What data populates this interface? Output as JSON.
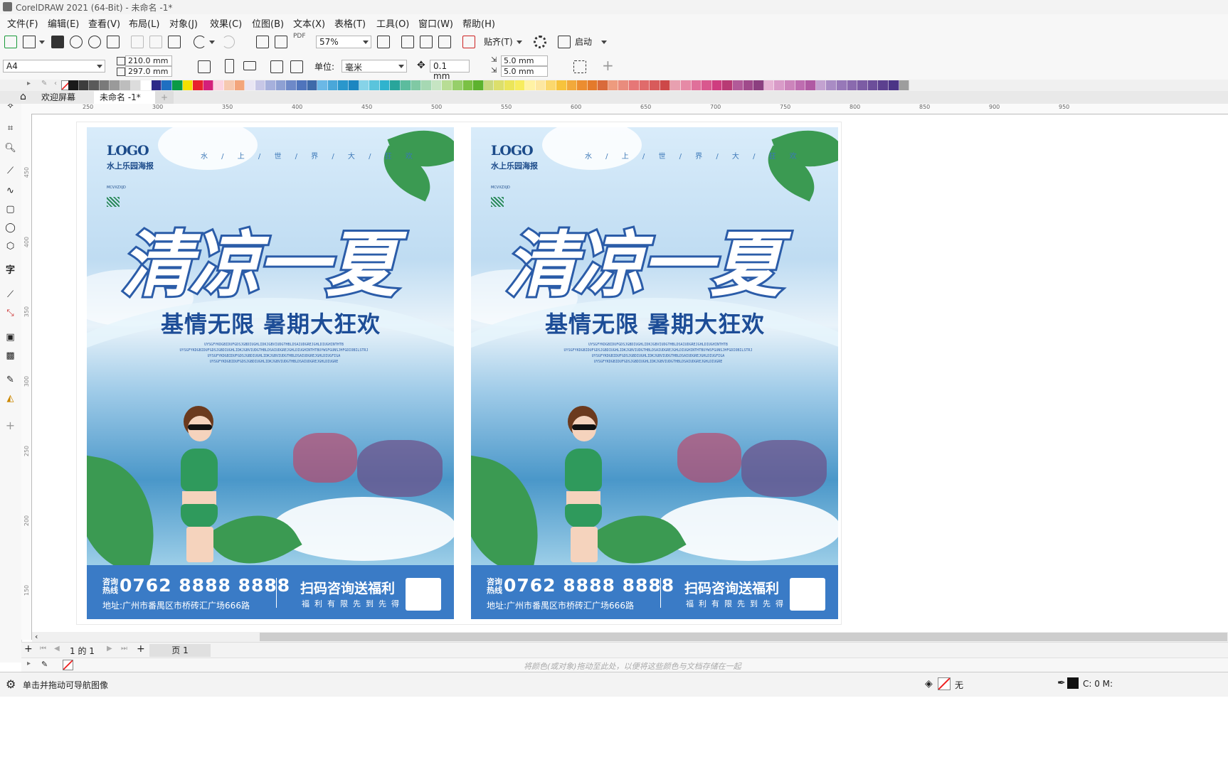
{
  "window": {
    "title": "CorelDRAW 2021 (64-Bit) - 未命名 -1*"
  },
  "menu": [
    "文件(F)",
    "编辑(E)",
    "查看(V)",
    "布局(L)",
    "对象(J)",
    "效果(C)",
    "位图(B)",
    "文本(X)",
    "表格(T)",
    "工具(O)",
    "窗口(W)",
    "帮助(H)"
  ],
  "toolbar": {
    "zoom": "57%",
    "snap_label": "贴齐(T)",
    "launch_label": "启动",
    "pdf_label": "PDF"
  },
  "propertybar": {
    "page_size": "A4",
    "width": "210.0 mm",
    "height": "297.0 mm",
    "units_label": "单位:",
    "units_value": "毫米",
    "nudge": "0.1 mm",
    "dup_x": "5.0 mm",
    "dup_y": "5.0 mm"
  },
  "palette": {
    "colors": [
      "#1a1a1a",
      "#3d3d3d",
      "#5a5a5a",
      "#7a7a7a",
      "#9a9a9a",
      "#bdbdbd",
      "#dcdcdc",
      "#ffffff",
      "#2d2a88",
      "#1f6fc1",
      "#0a9a46",
      "#f4e000",
      "#e8232d",
      "#d41f7a",
      "#fbd3e0",
      "#f6c9b0",
      "#f3a57b",
      "#e9e6f3",
      "#c7c7e6",
      "#a6b0dc",
      "#8ea0d3",
      "#6e89c8",
      "#4f74bc",
      "#3e6aa9",
      "#6bb8e6",
      "#4aa7d9",
      "#2a97cc",
      "#1c86c1",
      "#86d3e8",
      "#5bc4dc",
      "#30b3ce",
      "#29a59b",
      "#5cbc9e",
      "#80c9a4",
      "#a6d8b3",
      "#c6e5c3",
      "#b8dd95",
      "#97cf6a",
      "#7bc144",
      "#5db22e",
      "#c9d880",
      "#dcdf6c",
      "#ebe55a",
      "#f7ec5e",
      "#fff2a4",
      "#fde7a1",
      "#fbd86d",
      "#f7c33c",
      "#f2a93b",
      "#ec8d30",
      "#e47a2b",
      "#d96a3b",
      "#ee9b7e",
      "#e98c7d",
      "#e67777",
      "#e06b6b",
      "#d85b5b",
      "#cd4848",
      "#e8a0b0",
      "#e68aa6",
      "#e0709a",
      "#d9588e",
      "#cf3d80",
      "#b83a74",
      "#b25a99",
      "#a04a8b",
      "#8c3f80",
      "#e6b3d4",
      "#d99bc8",
      "#cc84bb",
      "#be6db0",
      "#b05aa3",
      "#c3a2d0",
      "#a98cc4",
      "#9778b8",
      "#8a6aae",
      "#7c5ca4",
      "#6c4e9a",
      "#5c408f",
      "#4b3486",
      "#9d9d9d"
    ]
  },
  "tabs": {
    "welcome": "欢迎屏幕",
    "document": "未命名 -1*",
    "add": "+"
  },
  "ruler_h": [
    "250",
    "300",
    "350",
    "400",
    "450",
    "500",
    "550",
    "600",
    "650",
    "700",
    "750",
    "800",
    "850",
    "900",
    "950"
  ],
  "ruler_v": [
    "450",
    "400",
    "350",
    "300",
    "250",
    "200",
    "150",
    "100",
    "50"
  ],
  "poster": {
    "logo": "LOGO",
    "sublogo": "水上乐园海报",
    "sublines": "MCVXZXJD",
    "tagline": "水 / 上 / 世 / 界 / 大 / 狂 欢",
    "headline": "清凉一夏",
    "subheadline": "基情无限 暑期大狂欢",
    "smallprint": "UYSGFYKDGBIDUFGDSJGBDIUGHLIDKJGBVIUDGTHBLDSAIUDGREJGHLDIUGHINTHTB UYSGFYKDGBIDUFGDSJGBDIUGHLIDKJGBVIUDGTHBLDSAIUDGREJGHLDIUGHINTHTBUYWSFGUNSJHFGDIOBILSTRJ UYSGFYKDGBIDUFGDSJGBDIUGHLIDKJGBVIUDGTHBLDSAIUDGREJGHLDIUGFIGA UYSGFYKDGBIDUFGDSJGBDIUGHLIDKJGBVIUDGTHBLDSAIUDGREJGHLDIUGRE",
    "hotline_label": "咨询热线",
    "phone": "0762 8888 8888",
    "address": "地址:广州市番禺区市桥砖汇广场666路",
    "qr_title": "扫码咨询送福利",
    "qr_subtitle": "福利有限先到先得"
  },
  "pagenav": {
    "count": "1 的 1",
    "page_tab": "页 1"
  },
  "docpalette_hint": "将颜色(或对象)拖动至此处，以便将这些颜色与文档存储在一起",
  "status": {
    "message": "单击并拖动可导航图像",
    "fill_label": "无",
    "outline_info": "C: 0 M:"
  }
}
